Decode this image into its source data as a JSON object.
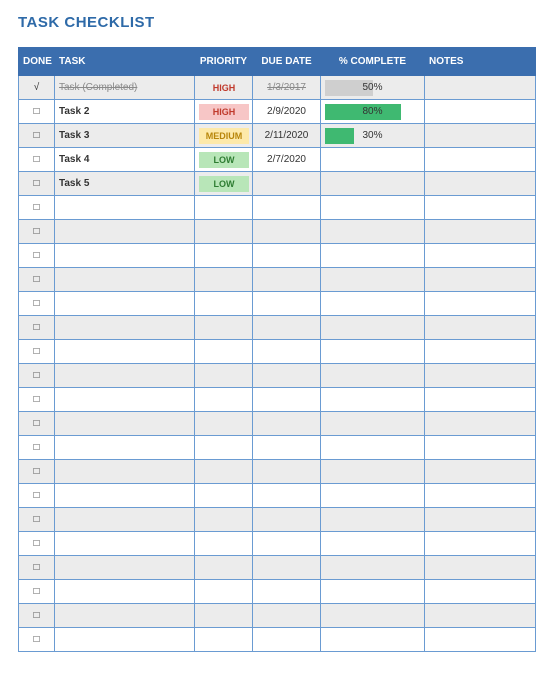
{
  "title": "TASK CHECKLIST",
  "columns": {
    "done": "DONE",
    "task": "TASK",
    "priority": "PRIORITY",
    "due": "DUE DATE",
    "pct": "% COMPLETE",
    "notes": "NOTES"
  },
  "glyphs": {
    "check": "√",
    "box": "□"
  },
  "rows": [
    {
      "done": true,
      "task": "Task (Completed)",
      "priority": "HIGH",
      "priority_bg": "gray",
      "due": "1/3/2017",
      "pct": 50,
      "pct_style": "dim",
      "notes": ""
    },
    {
      "done": false,
      "task": "Task 2",
      "priority": "HIGH",
      "priority_bg": "pink",
      "due": "2/9/2020",
      "pct": 80,
      "pct_style": "full",
      "notes": ""
    },
    {
      "done": false,
      "task": "Task 3",
      "priority": "MEDIUM",
      "priority_bg": "yellow",
      "due": "2/11/2020",
      "pct": 30,
      "pct_style": "full",
      "notes": ""
    },
    {
      "done": false,
      "task": "Task 4",
      "priority": "LOW",
      "priority_bg": "green",
      "due": "2/7/2020",
      "pct": null,
      "pct_style": null,
      "notes": ""
    },
    {
      "done": false,
      "task": "Task 5",
      "priority": "LOW",
      "priority_bg": "green",
      "due": "",
      "pct": null,
      "pct_style": null,
      "notes": ""
    },
    {
      "done": false,
      "task": "",
      "priority": null,
      "priority_bg": null,
      "due": "",
      "pct": null,
      "pct_style": null,
      "notes": ""
    },
    {
      "done": false,
      "task": "",
      "priority": null,
      "priority_bg": null,
      "due": "",
      "pct": null,
      "pct_style": null,
      "notes": ""
    },
    {
      "done": false,
      "task": "",
      "priority": null,
      "priority_bg": null,
      "due": "",
      "pct": null,
      "pct_style": null,
      "notes": ""
    },
    {
      "done": false,
      "task": "",
      "priority": null,
      "priority_bg": null,
      "due": "",
      "pct": null,
      "pct_style": null,
      "notes": ""
    },
    {
      "done": false,
      "task": "",
      "priority": null,
      "priority_bg": null,
      "due": "",
      "pct": null,
      "pct_style": null,
      "notes": ""
    },
    {
      "done": false,
      "task": "",
      "priority": null,
      "priority_bg": null,
      "due": "",
      "pct": null,
      "pct_style": null,
      "notes": ""
    },
    {
      "done": false,
      "task": "",
      "priority": null,
      "priority_bg": null,
      "due": "",
      "pct": null,
      "pct_style": null,
      "notes": ""
    },
    {
      "done": false,
      "task": "",
      "priority": null,
      "priority_bg": null,
      "due": "",
      "pct": null,
      "pct_style": null,
      "notes": ""
    },
    {
      "done": false,
      "task": "",
      "priority": null,
      "priority_bg": null,
      "due": "",
      "pct": null,
      "pct_style": null,
      "notes": ""
    },
    {
      "done": false,
      "task": "",
      "priority": null,
      "priority_bg": null,
      "due": "",
      "pct": null,
      "pct_style": null,
      "notes": ""
    },
    {
      "done": false,
      "task": "",
      "priority": null,
      "priority_bg": null,
      "due": "",
      "pct": null,
      "pct_style": null,
      "notes": ""
    },
    {
      "done": false,
      "task": "",
      "priority": null,
      "priority_bg": null,
      "due": "",
      "pct": null,
      "pct_style": null,
      "notes": ""
    },
    {
      "done": false,
      "task": "",
      "priority": null,
      "priority_bg": null,
      "due": "",
      "pct": null,
      "pct_style": null,
      "notes": ""
    },
    {
      "done": false,
      "task": "",
      "priority": null,
      "priority_bg": null,
      "due": "",
      "pct": null,
      "pct_style": null,
      "notes": ""
    },
    {
      "done": false,
      "task": "",
      "priority": null,
      "priority_bg": null,
      "due": "",
      "pct": null,
      "pct_style": null,
      "notes": ""
    },
    {
      "done": false,
      "task": "",
      "priority": null,
      "priority_bg": null,
      "due": "",
      "pct": null,
      "pct_style": null,
      "notes": ""
    },
    {
      "done": false,
      "task": "",
      "priority": null,
      "priority_bg": null,
      "due": "",
      "pct": null,
      "pct_style": null,
      "notes": ""
    },
    {
      "done": false,
      "task": "",
      "priority": null,
      "priority_bg": null,
      "due": "",
      "pct": null,
      "pct_style": null,
      "notes": ""
    },
    {
      "done": false,
      "task": "",
      "priority": null,
      "priority_bg": null,
      "due": "",
      "pct": null,
      "pct_style": null,
      "notes": ""
    }
  ]
}
